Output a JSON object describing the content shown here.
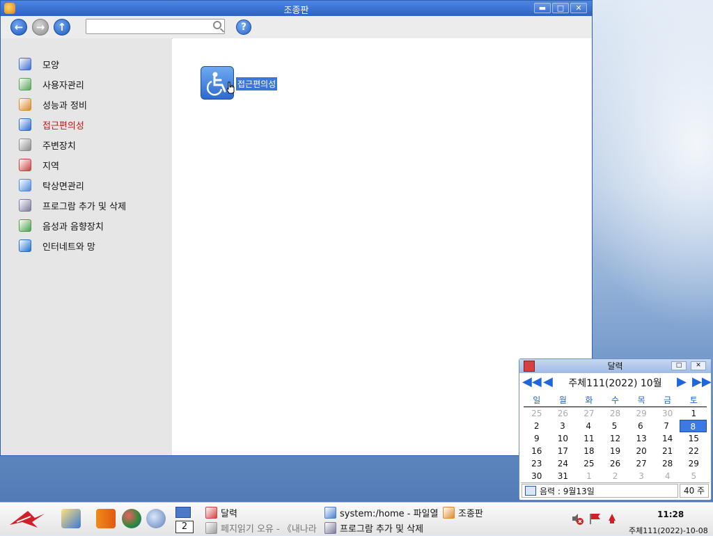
{
  "window": {
    "title": "조종판",
    "buttons": {
      "minimize": "▬",
      "maximize": "□",
      "close": "✕"
    }
  },
  "toolbar": {
    "search": {
      "value": "",
      "placeholder": ""
    },
    "help_label": "?"
  },
  "sidebar": {
    "items": [
      {
        "label": "모양",
        "icon": "appearance-icon",
        "color": "#3a6cc9"
      },
      {
        "label": "사용자관리",
        "icon": "users-icon",
        "color": "#5aa25a"
      },
      {
        "label": "성능과 정비",
        "icon": "performance-icon",
        "color": "#d88a2a"
      },
      {
        "label": "접근편의성",
        "icon": "accessibility-icon",
        "color": "#2c6bd0",
        "active": true
      },
      {
        "label": "주변장치",
        "icon": "devices-icon",
        "color": "#8a8a8a"
      },
      {
        "label": "지역",
        "icon": "region-icon",
        "color": "#c94040"
      },
      {
        "label": "탁상면관리",
        "icon": "desktop-icon",
        "color": "#4a8ad8"
      },
      {
        "label": "프로그람 추가 및 삭제",
        "icon": "programs-icon",
        "color": "#7a7a9a"
      },
      {
        "label": "음성과 음향장치",
        "icon": "sound-icon",
        "color": "#4aa04a"
      },
      {
        "label": "인터네트와 망",
        "icon": "network-icon",
        "color": "#1f6fd0"
      }
    ]
  },
  "main": {
    "items": [
      {
        "label": "접근편의성",
        "icon": "wheelchair-icon"
      }
    ]
  },
  "calendar": {
    "title": "달력",
    "month_label": "주체111(2022) 10월",
    "weekdays": [
      "일",
      "월",
      "화",
      "수",
      "목",
      "금",
      "토"
    ],
    "weeks": [
      [
        "25",
        "26",
        "27",
        "28",
        "29",
        "30",
        "1"
      ],
      [
        "2",
        "3",
        "4",
        "5",
        "6",
        "7",
        "8"
      ],
      [
        "9",
        "10",
        "11",
        "12",
        "13",
        "14",
        "15"
      ],
      [
        "16",
        "17",
        "18",
        "19",
        "20",
        "21",
        "22"
      ],
      [
        "23",
        "24",
        "25",
        "26",
        "27",
        "28",
        "29"
      ],
      [
        "30",
        "31",
        "1",
        "2",
        "3",
        "4",
        "5"
      ]
    ],
    "selected_day": "8",
    "lunar_text": "음력 : 9월13일",
    "week_label": "40 주"
  },
  "taskbar": {
    "pager_page": "2",
    "tasks": [
      {
        "label": "달력",
        "icon": "calendar-icon",
        "color": "#d64040"
      },
      {
        "label": "페지읽기 오유 - 《내나라》",
        "icon": "browser-icon",
        "color": "#9a9a9a",
        "dim": true
      },
      {
        "label": "system:/home - 파일열람기",
        "icon": "folder-icon",
        "color": "#4a7fd0"
      },
      {
        "label": "프로그람 추가 및 삭제",
        "icon": "programs-icon",
        "color": "#7a7a9a"
      },
      {
        "label": "조종판",
        "icon": "control-panel-icon",
        "color": "#e08a2a"
      }
    ],
    "clock_time": "11:28",
    "clock_date": "주체111(2022)-10-08"
  }
}
